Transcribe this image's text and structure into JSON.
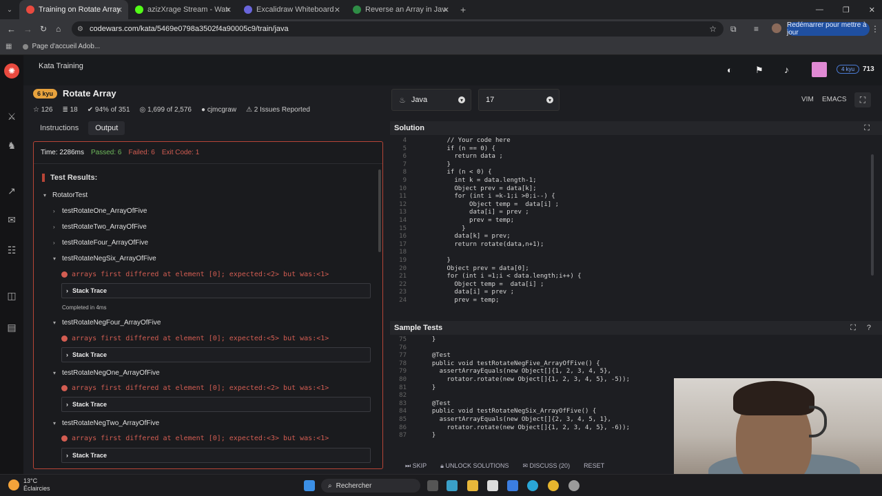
{
  "browser": {
    "tabs": [
      {
        "title": "Training on Rotate Array | Code",
        "active": true,
        "color": "#e94a3f"
      },
      {
        "title": "azizXrage Stream - Watch Live",
        "active": false,
        "color": "#53fc18"
      },
      {
        "title": "Excalidraw Whiteboard",
        "active": false,
        "color": "#6965db"
      },
      {
        "title": "Reverse an Array in Java - Geek",
        "active": false,
        "color": "#2f8d46"
      }
    ],
    "url": "codewars.com/kata/5469e0798a3502f4a90005c9/train/java",
    "bookmark": "Page d'accueil Adob...",
    "relaunch": "Redémarrer pour mettre à jour"
  },
  "header": {
    "section": "Kata Training",
    "rank_badge": "4 kyu",
    "honor": "713"
  },
  "kata": {
    "rank": "6 kyu",
    "title": "Rotate Array",
    "votes": "126",
    "collections": "18",
    "satisfaction": "94% of 351",
    "completed": "1,699 of 2,576",
    "author": "cjmcgraw",
    "issues": "2 Issues Reported",
    "tabs": [
      "Instructions",
      "Output"
    ]
  },
  "output": {
    "time": "Time: 2286ms",
    "passed": "Passed: 6",
    "failed": "Failed: 6",
    "exit": "Exit Code: 1",
    "results_title": "Test Results:",
    "group": "RotatorTest",
    "tests_collapsed": [
      "testRotateOne_ArrayOfFive",
      "testRotateTwo_ArrayOfFive",
      "testRotateFour_ArrayOfFive"
    ],
    "failures": [
      {
        "name": "testRotateNegSix_ArrayOfFive",
        "message": "arrays first differed at element [0]; expected:<2> but was:<1>",
        "completed": "Completed in 4ms"
      },
      {
        "name": "testRotateNegFour_ArrayOfFive",
        "message": "arrays first differed at element [0]; expected:<5> but was:<1>"
      },
      {
        "name": "testRotateNegOne_ArrayOfFive",
        "message": "arrays first differed at element [0]; expected:<2> but was:<1>"
      },
      {
        "name": "testRotateNegTwo_ArrayOfFive",
        "message": "arrays first differed at element [0]; expected:<3> but was:<1>"
      }
    ],
    "stack_label": "Stack Trace"
  },
  "editor": {
    "language": "Java",
    "version": "17",
    "modes": [
      "VIM",
      "EMACS"
    ],
    "solution_title": "Solution",
    "solution_lines": [
      {
        "n": "4",
        "t": "      // Your code here"
      },
      {
        "n": "5",
        "t": "      if (n == 0) {"
      },
      {
        "n": "6",
        "t": "        return data ;"
      },
      {
        "n": "7",
        "t": "      }"
      },
      {
        "n": "8",
        "t": "      if (n < 0) {"
      },
      {
        "n": "9",
        "t": "        int k = data.length-1;"
      },
      {
        "n": "10",
        "t": "        Object prev = data[k];"
      },
      {
        "n": "11",
        "t": "        for (int i =k-1;i >0;i--) {"
      },
      {
        "n": "12",
        "t": "            Object temp =  data[i] ;"
      },
      {
        "n": "13",
        "t": "            data[i] = prev ;"
      },
      {
        "n": "14",
        "t": "            prev = temp;"
      },
      {
        "n": "15",
        "t": "          }"
      },
      {
        "n": "16",
        "t": "        data[k] = prev;"
      },
      {
        "n": "17",
        "t": "        return rotate(data,n+1);"
      },
      {
        "n": "18",
        "t": ""
      },
      {
        "n": "19",
        "t": "      }"
      },
      {
        "n": "20",
        "t": "      Object prev = data[0];"
      },
      {
        "n": "21",
        "t": "      for (int i =1;i < data.length;i++) {"
      },
      {
        "n": "22",
        "t": "        Object temp =  data[i] ;"
      },
      {
        "n": "23",
        "t": "        data[i] = prev ;"
      },
      {
        "n": "24",
        "t": "        prev = temp;"
      }
    ],
    "tests_title": "Sample Tests",
    "test_lines": [
      {
        "n": "75",
        "t": "  }"
      },
      {
        "n": "76",
        "t": ""
      },
      {
        "n": "77",
        "t": "  @Test"
      },
      {
        "n": "78",
        "t": "  public void testRotateNegFive_ArrayOfFive() {"
      },
      {
        "n": "79",
        "t": "    assertArrayEquals(new Object[]{1, 2, 3, 4, 5},"
      },
      {
        "n": "80",
        "t": "      rotator.rotate(new Object[]{1, 2, 3, 4, 5}, -5));"
      },
      {
        "n": "81",
        "t": "  }"
      },
      {
        "n": "82",
        "t": ""
      },
      {
        "n": "83",
        "t": "  @Test"
      },
      {
        "n": "84",
        "t": "  public void testRotateNegSix_ArrayOfFive() {"
      },
      {
        "n": "85",
        "t": "    assertArrayEquals(new Object[]{2, 3, 4, 5, 1},"
      },
      {
        "n": "86",
        "t": "      rotator.rotate(new Object[]{1, 2, 3, 4, 5}, -6));"
      },
      {
        "n": "87",
        "t": "  }"
      }
    ],
    "actions": [
      "SKIP",
      "UNLOCK SOLUTIONS",
      "DISCUSS (20)",
      "RESET"
    ]
  },
  "taskbar": {
    "weather_temp": "13°C",
    "weather_text": "Éclaircies",
    "search": "Rechercher"
  }
}
